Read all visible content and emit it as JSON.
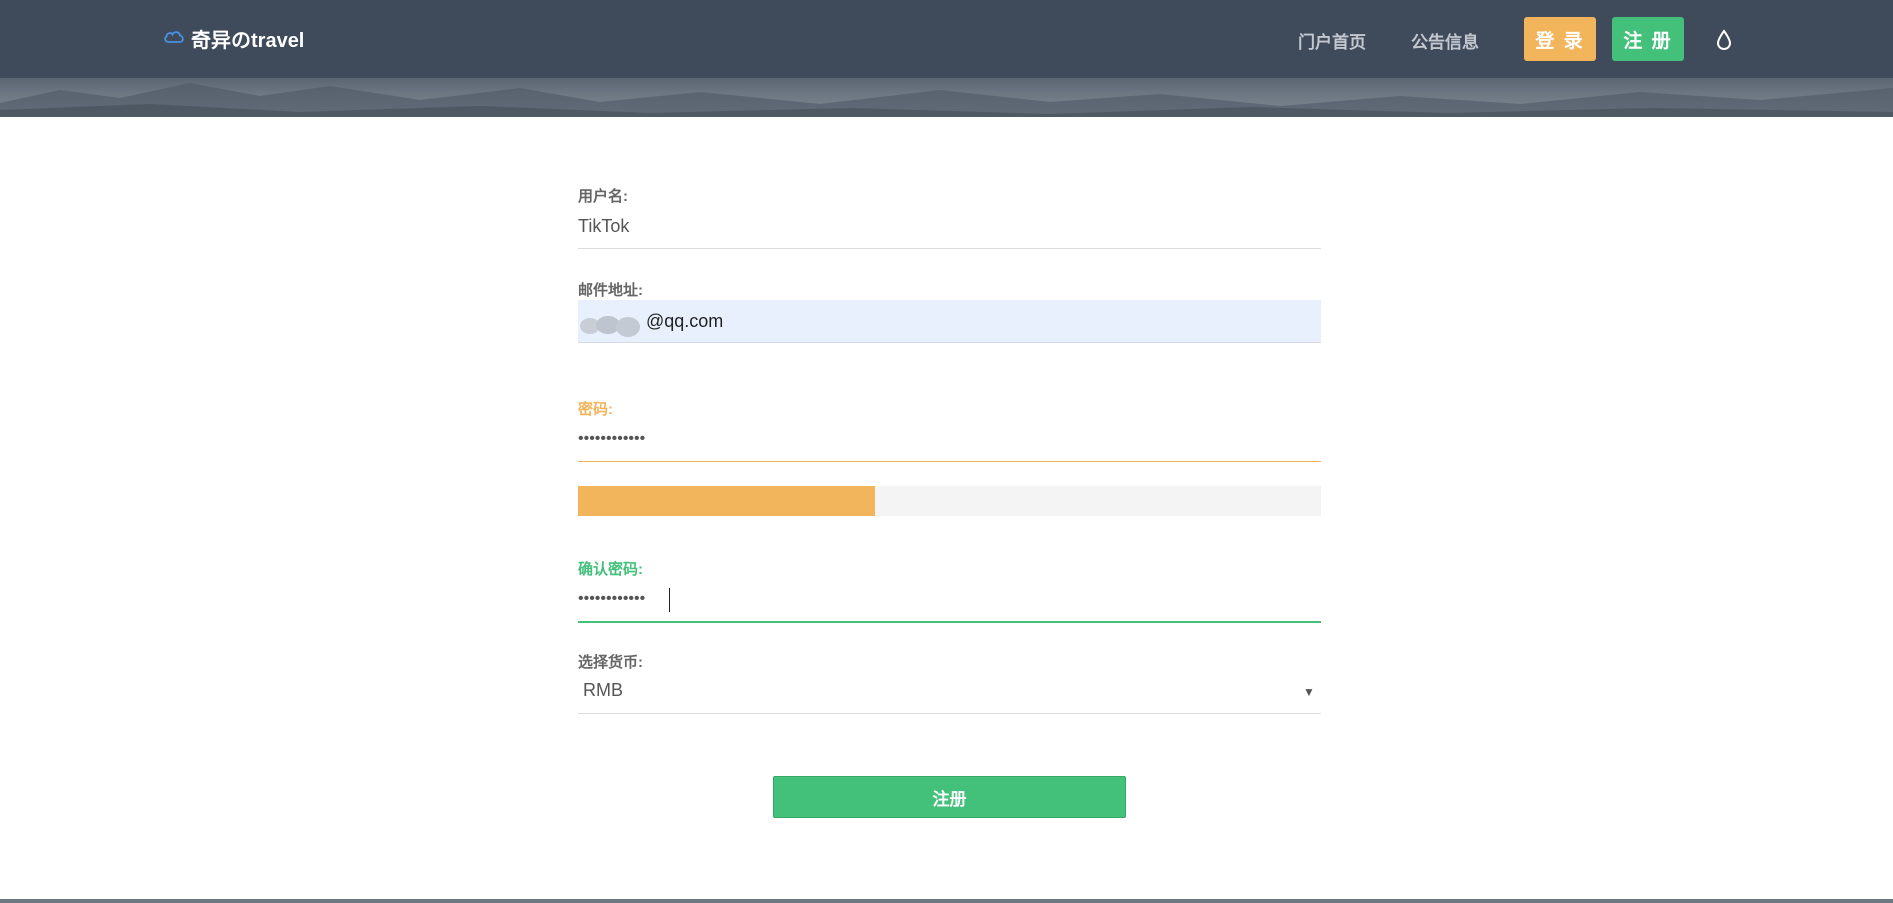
{
  "brand": {
    "name": "奇异のtravel"
  },
  "nav": {
    "home": "门户首页",
    "notice": "公告信息",
    "login": "登 录",
    "register": "注 册"
  },
  "form": {
    "username": {
      "label": "用户名:",
      "value": "TikTok"
    },
    "email": {
      "label": "邮件地址:",
      "value": "@qq.com"
    },
    "password": {
      "label": "密码:",
      "value": "••••••••••••",
      "strength_percent": 40
    },
    "confirm_password": {
      "label": "确认密码:",
      "value": "••••••••••••"
    },
    "currency": {
      "label": "选择货币:",
      "value": "RMB"
    },
    "submit_label": "注册"
  },
  "colors": {
    "navbar": "#3f4a5b",
    "accent_orange": "#f3b55c",
    "accent_green": "#43c07a"
  },
  "icons": {
    "brand_logo": "cloud-icon",
    "theme_toggle": "droplet-icon",
    "select_arrow": "caret-down-icon"
  }
}
